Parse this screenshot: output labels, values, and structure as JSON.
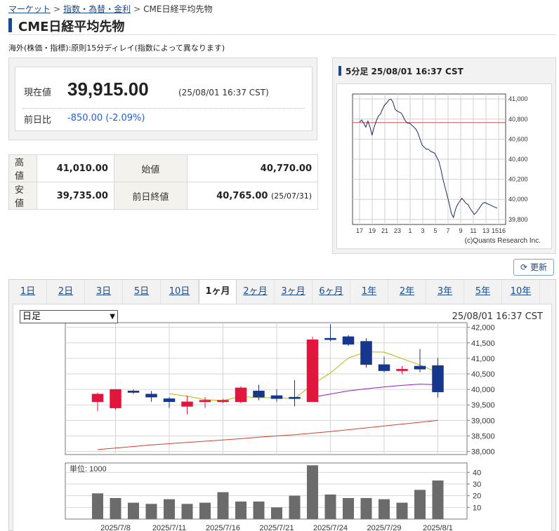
{
  "breadcrumb": {
    "item1": "マーケット",
    "item2": "指数・為替・金利",
    "sep": ">",
    "current": "CME日経平均先物"
  },
  "page_title": "CME日経平均先物",
  "subnote": "海外(株価・指標):原則15分ディレイ(指数によって異なります)",
  "price": {
    "label": "現在値",
    "value": "39,915.00",
    "time": "(25/08/01 16:37 CST)",
    "change_label": "前日比",
    "change": "-850.00 (-2.09%)"
  },
  "ohlc": {
    "high_label": "高値",
    "high": "41,010.00",
    "open_label": "始値",
    "open": "40,770.00",
    "low_label": "安値",
    "low": "39,735.00",
    "prev_label": "前日終値",
    "prev": "40,765.00",
    "prev_date": "(25/07/31)"
  },
  "mini_chart_title": "5分足 25/08/01 16:37 CST",
  "refresh_label": "更新",
  "tabs": [
    "1日",
    "2日",
    "3日",
    "5日",
    "10日",
    "1ヶ月",
    "2ヶ月",
    "3ヶ月",
    "6ヶ月",
    "1年",
    "2年",
    "3年",
    "5年",
    "10年"
  ],
  "active_tab": 5,
  "chart_select": "日足",
  "chart_time": "25/08/01 16:37 CST",
  "colors": {
    "up": "#e0163c",
    "down": "#16378c",
    "accent": "#1a4a8c",
    "ma_short": "#b5b800",
    "ma_mid": "#8a1fc8",
    "ma_long": "#d0402a",
    "volume": "#6b6b6b",
    "prev_close_line": "#d05050"
  },
  "chart_data": [
    {
      "type": "line",
      "title": "5分足 25/08/01 16:37 CST",
      "x_ticks": [
        "17",
        "19",
        "21",
        "23",
        "1",
        "3",
        "5",
        "7",
        "9",
        "11",
        "13",
        "1516"
      ],
      "y_ticks": [
        "41,000",
        "40,800",
        "40,600",
        "40,400",
        "40,200",
        "40,000",
        "39,800"
      ],
      "ylim": [
        39750,
        41050
      ],
      "reference_line": 40765,
      "credit": "(c)Quants Research Inc.",
      "values": [
        40770,
        40790,
        40760,
        40720,
        40780,
        40720,
        40640,
        40720,
        40780,
        40830,
        40850,
        40900,
        40940,
        40960,
        40990,
        41000,
        40970,
        40900,
        40880,
        40870,
        40860,
        40820,
        40780,
        40760,
        40760,
        40740,
        40720,
        40700,
        40660,
        40600,
        40540,
        40520,
        40500,
        40500,
        40480,
        40470,
        40460,
        40420,
        40380,
        40300,
        40200,
        40120,
        40040,
        39960,
        39860,
        39820,
        39900,
        39950,
        39980,
        40010,
        39990,
        39960,
        39950,
        39910,
        39880,
        39850,
        39870,
        39900,
        39930,
        39960,
        39970,
        39960,
        39950,
        39940,
        39930,
        39920,
        39915
      ]
    },
    {
      "type": "candlestick",
      "x_ticks": [
        "2025/7/8",
        "2025/7/11",
        "2025/7/16",
        "2025/7/21",
        "2025/7/24",
        "2025/7/29",
        "2025/8/1"
      ],
      "y_ticks": [
        "42,000",
        "41,500",
        "41,000",
        "40,500",
        "40,000",
        "39,500",
        "39,000",
        "38,500",
        "38,000"
      ],
      "ylim": [
        37900,
        42150
      ],
      "dates": [
        "2025/7/7",
        "2025/7/8",
        "2025/7/9",
        "2025/7/10",
        "2025/7/11",
        "2025/7/14",
        "2025/7/15",
        "2025/7/16",
        "2025/7/17",
        "2025/7/18",
        "2025/7/21",
        "2025/7/22",
        "2025/7/23",
        "2025/7/24",
        "2025/7/25",
        "2025/7/28",
        "2025/7/29",
        "2025/7/30",
        "2025/7/31",
        "2025/8/1"
      ],
      "open": [
        39600,
        39400,
        39950,
        39850,
        39700,
        39450,
        39600,
        39600,
        39600,
        39950,
        39800,
        39750,
        39600,
        41650,
        41700,
        41550,
        40800,
        40600,
        40750,
        40770
      ],
      "high": [
        39900,
        40000,
        40000,
        39950,
        39750,
        39800,
        39750,
        39700,
        40100,
        40150,
        40000,
        40300,
        41700,
        42100,
        41750,
        41650,
        41050,
        40750,
        41300,
        41010
      ],
      "low": [
        39300,
        39350,
        39850,
        39600,
        39400,
        39200,
        39400,
        39550,
        39550,
        39650,
        39600,
        39450,
        39600,
        41550,
        41400,
        40700,
        40550,
        40500,
        40550,
        39735
      ],
      "close": [
        39850,
        40000,
        39900,
        39750,
        39600,
        39600,
        39650,
        39650,
        40050,
        39750,
        39700,
        39700,
        41600,
        41600,
        41450,
        40800,
        40600,
        40650,
        40650,
        39915
      ],
      "ma_short": [
        null,
        null,
        null,
        null,
        39860,
        39780,
        39670,
        39640,
        39770,
        39730,
        39730,
        39700,
        40160,
        40530,
        41010,
        41210,
        41200,
        40990,
        40790,
        40540
      ],
      "ma_mid": [
        null,
        null,
        null,
        null,
        null,
        null,
        null,
        null,
        null,
        null,
        null,
        null,
        39750,
        39850,
        39950,
        40020,
        40080,
        40130,
        40170,
        40150
      ],
      "ma_long": [
        38060,
        38110,
        38160,
        38210,
        38250,
        38290,
        38330,
        38370,
        38410,
        38460,
        38500,
        38540,
        38590,
        38640,
        38700,
        38760,
        38820,
        38880,
        38940,
        39000
      ],
      "volume_unit": "単位: 1000",
      "volume_ticks": [
        "40",
        "30",
        "20",
        "10"
      ],
      "volume_ylim": [
        0,
        48
      ],
      "volume": [
        22,
        18,
        14,
        13,
        17,
        13,
        14,
        23,
        15,
        15,
        10,
        20,
        46,
        21,
        18,
        18,
        17,
        14,
        25,
        33
      ]
    }
  ]
}
